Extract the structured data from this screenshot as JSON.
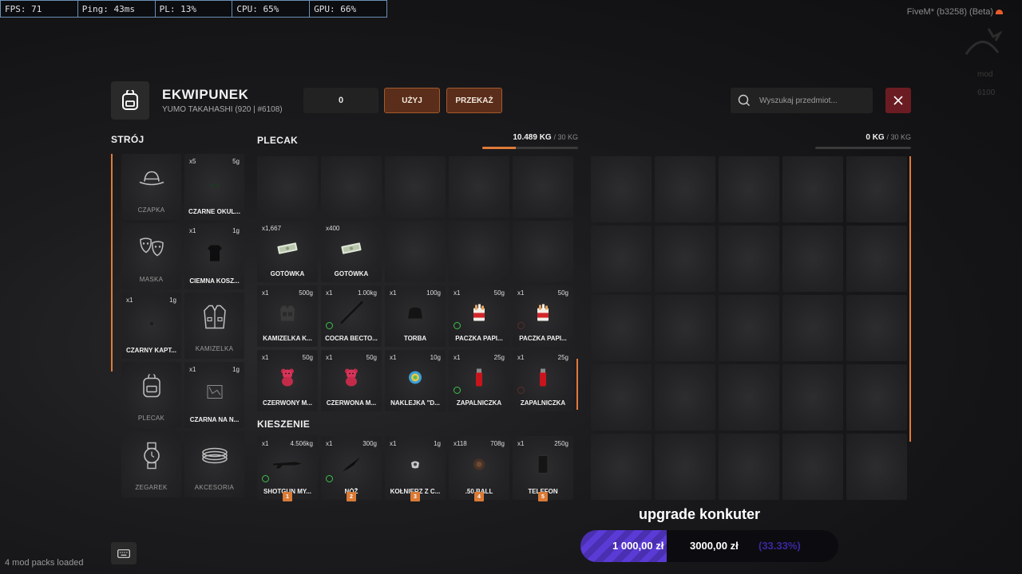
{
  "stats": [
    {
      "label": "FPS: 71"
    },
    {
      "label": "Ping: 43ms"
    },
    {
      "label": "PL: 13%"
    },
    {
      "label": "CPU: 65%"
    },
    {
      "label": "GPU: 66%"
    }
  ],
  "client": {
    "version": "FiveM* (b3258) (Beta)"
  },
  "background_hud": {
    "line1": "mod",
    "line2": "6100"
  },
  "header": {
    "title": "EKWIPUNEK",
    "subtitle": "YUMO TAKAHASHI (920 | #6108)",
    "quantity": "0",
    "use_label": "UŻYJ",
    "give_label": "PRZEKAŻ",
    "search_placeholder": "Wyszukaj przedmiot..."
  },
  "outfit": {
    "title": "STRÓJ",
    "slots": [
      {
        "placeholder": "CZAPKA",
        "icon": "hat-icon"
      },
      {
        "count": "x5",
        "weight": "5g",
        "name": "CZARNE OKUL...",
        "icon": "glasses-icon"
      },
      {
        "placeholder": "MASKA",
        "icon": "mask-icon"
      },
      {
        "count": "x1",
        "weight": "1g",
        "name": "CIEMNA KOSZ...",
        "icon": "shirt-icon"
      },
      {
        "count": "x1",
        "weight": "1g",
        "name": "CZARNY KAPT...",
        "icon": "hoodie-icon"
      },
      {
        "placeholder": "KAMIZELKA",
        "icon": "vest-icon"
      },
      {
        "placeholder": "PLECAK",
        "icon": "backpack-icon"
      },
      {
        "count": "x1",
        "weight": "1g",
        "name": "CZARNA NA N...",
        "icon": "pants-icon"
      },
      {
        "placeholder": "ZEGAREK",
        "icon": "watch-icon"
      },
      {
        "placeholder": "AKCESORIA",
        "icon": "bracelet-icon"
      }
    ]
  },
  "backpack": {
    "title": "PLECAK",
    "weight": "10.489 KG",
    "max": "/ 30 KG",
    "fill_fraction": 0.35,
    "slots": [
      {},
      {},
      {},
      {},
      {},
      {
        "count": "x1,667",
        "name": "GOTÓWKA",
        "icon": "cash-icon"
      },
      {
        "count": "x400",
        "name": "GOTÓWKA",
        "icon": "cash-icon"
      },
      {},
      {},
      {},
      {
        "count": "x1",
        "weight": "500g",
        "name": "KAMIZELKA K...",
        "icon": "vest-item-icon"
      },
      {
        "count": "x1",
        "weight": "1.00kg",
        "name": "COCRA BECTO...",
        "icon": "stick-icon",
        "ring": "green"
      },
      {
        "count": "x1",
        "weight": "100g",
        "name": "TORBA",
        "icon": "bag-item-icon"
      },
      {
        "count": "x1",
        "weight": "50g",
        "name": "PACZKA PAPI...",
        "icon": "cigarettes-icon",
        "ring": "green"
      },
      {
        "count": "x1",
        "weight": "50g",
        "name": "PACZKA PAPI...",
        "icon": "cigarettes-icon",
        "ring": "dim"
      },
      {
        "count": "x1",
        "weight": "50g",
        "name": "CZERWONY M...",
        "icon": "teddy-icon"
      },
      {
        "count": "x1",
        "weight": "50g",
        "name": "CZERWONA M...",
        "icon": "teddy-icon"
      },
      {
        "count": "x1",
        "weight": "10g",
        "name": "NAKLEJKA \"D...",
        "icon": "sticker-icon"
      },
      {
        "count": "x1",
        "weight": "25g",
        "name": "ZAPALNICZKA",
        "icon": "lighter-icon",
        "ring": "green"
      },
      {
        "count": "x1",
        "weight": "25g",
        "name": "ZAPALNICZKA",
        "icon": "lighter-icon",
        "ring": "dim"
      }
    ]
  },
  "pockets": {
    "title": "KIESZENIE",
    "slots": [
      {
        "count": "x1",
        "weight": "4.506kg",
        "name": "SHOTGUN MY...",
        "icon": "shotgun-icon",
        "ring": "green",
        "hotkey": "1"
      },
      {
        "count": "x1",
        "weight": "300g",
        "name": "NÓŻ",
        "icon": "knife-icon",
        "ring": "green",
        "hotkey": "2"
      },
      {
        "count": "x1",
        "weight": "1g",
        "name": "KOŁNIERZ Z C...",
        "icon": "collar-icon",
        "hotkey": "3"
      },
      {
        "count": "x118",
        "weight": "708g",
        "name": ".50 BALL",
        "icon": "ammo-icon",
        "hotkey": "4"
      },
      {
        "count": "x1",
        "weight": "250g",
        "name": "TELEFON",
        "icon": "phone-icon",
        "hotkey": "5"
      }
    ]
  },
  "ground": {
    "weight": "0 KG",
    "max": "/ 30 KG",
    "fill_fraction": 0,
    "slot_count": 25
  },
  "upgrade": {
    "title": "upgrade konkuter",
    "current": "1 000,00 zł",
    "goal": "3000,00 zł",
    "percent": "(33.33%)",
    "fill_fraction": 0.3333
  },
  "footer": {
    "modpacks": "4 mod packs loaded"
  },
  "colors": {
    "accent": "#e07a3a",
    "close": "#6b1c22",
    "button_bg": "#5a2e1a",
    "ring_green": "#3cc24a",
    "progress": "#5b3bd6"
  }
}
